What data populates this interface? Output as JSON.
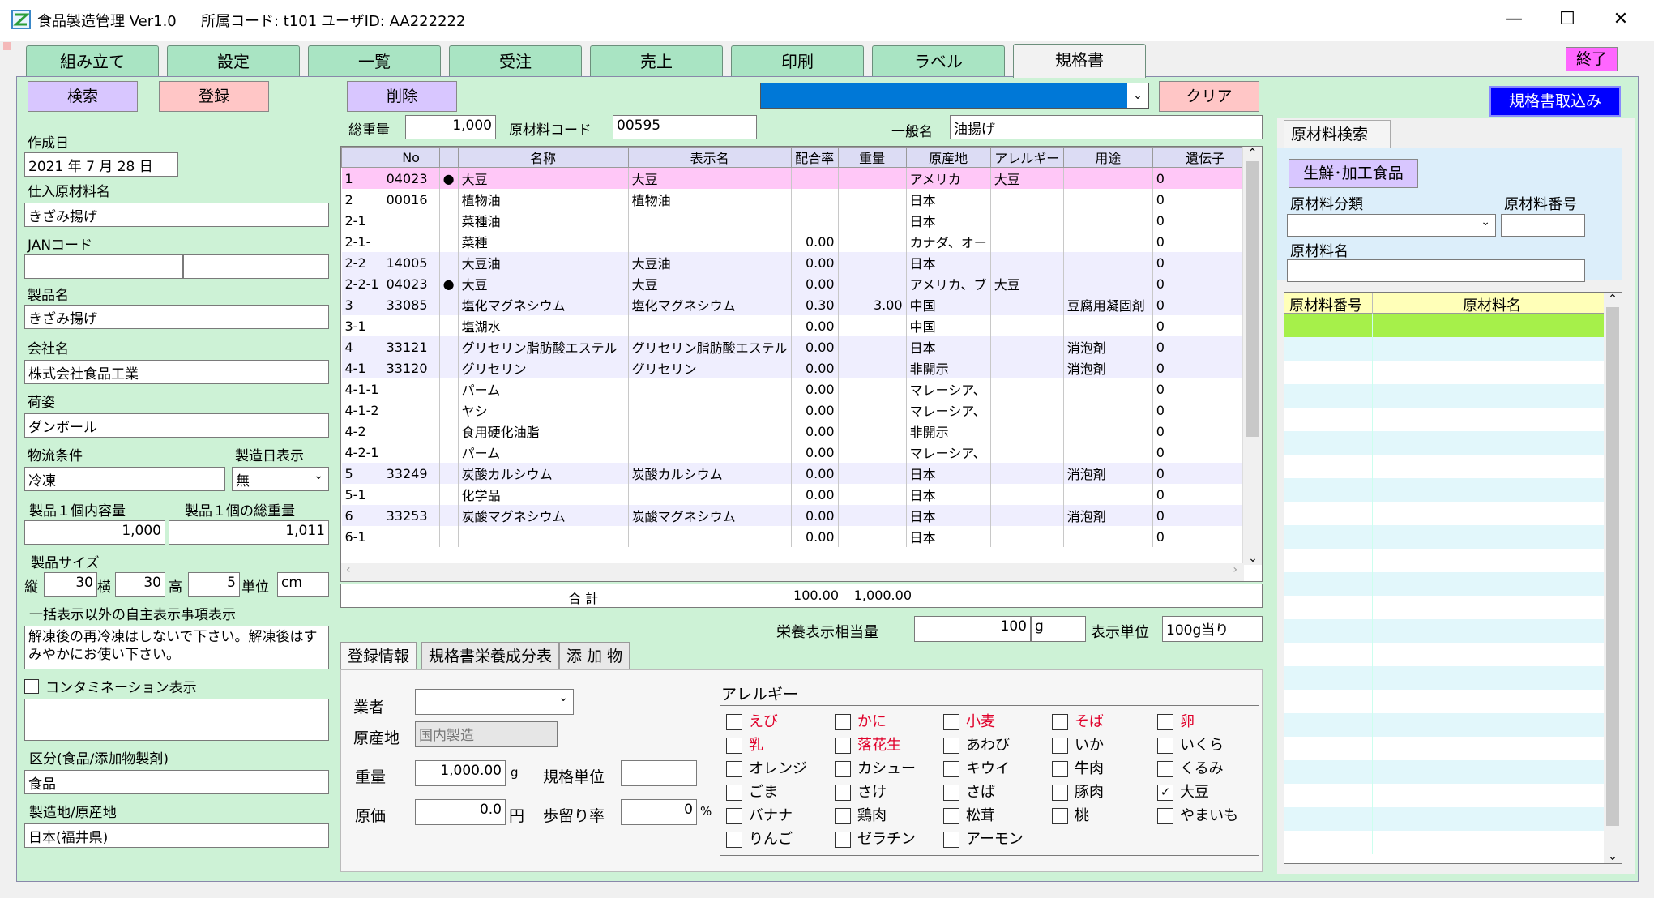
{
  "titlebar": {
    "app_title": "食品製造管理 Ver1.0",
    "office_code": "所属コード: t101",
    "user_id": "ユーザID: AA222222",
    "minimize": "—",
    "maximize": "☐",
    "close": "✕"
  },
  "tabs": [
    {
      "label": "組み立て"
    },
    {
      "label": "設定"
    },
    {
      "label": "一覧"
    },
    {
      "label": "受注"
    },
    {
      "label": "売上"
    },
    {
      "label": "印刷"
    },
    {
      "label": "ラベル"
    },
    {
      "label": "規格書"
    }
  ],
  "exit_label": "終了",
  "toolbar": {
    "search": "検索",
    "register": "登録",
    "delete": "削除",
    "clear": "クリア",
    "import": "規格書取込み"
  },
  "left": {
    "created_date_label": "作成日",
    "created_date": "2021 年 7 月 28 日",
    "material_name_label": "仕入原材料名",
    "material_name": "きざみ揚げ",
    "jan_label": "JANコード",
    "jan_1": "",
    "jan_2": "",
    "product_name_label": "製品名",
    "product_name": "きざみ揚げ",
    "company_label": "会社名",
    "company": "株式会社食品工業",
    "packing_label": "荷姿",
    "packing": "ダンボール",
    "logistics_label": "物流条件",
    "logistics": "冷凍",
    "mfg_date_label": "製造日表示",
    "mfg_date": "無",
    "capacity_label": "製品１個内容量",
    "capacity": "1,000",
    "total_weight_label": "製品１個の総重量",
    "total_weight": "1,011",
    "size_label": "製品サイズ",
    "size_h_label": "縦",
    "size_h": "30",
    "size_w_label": "横",
    "size_w": "30",
    "size_d_label": "高",
    "size_d": "5",
    "unit_label": "単位",
    "unit": "cm",
    "voluntary_label": "一括表示以外の自主表示事項表示",
    "voluntary_text": "解凍後の再冷凍はしないで下さい。解凍後はすみやかにお使い下さい。",
    "contamination_label": "コンタミネーション表示",
    "category_label": "区分(食品/添加物製剤)",
    "category": "食品",
    "origin_label": "製造地/原産地",
    "origin": "日本(福井県)"
  },
  "header_fields": {
    "total_weight_label": "総重量",
    "total_weight": "1,000",
    "material_code_label": "原材料コード",
    "material_code": "00595",
    "general_name_label": "一般名",
    "general_name": "油揚げ"
  },
  "grid": {
    "columns": [
      "",
      "No",
      "",
      "名称",
      "表示名",
      "配合率",
      "重量",
      "原産地",
      "アレルギー",
      "用途",
      "遺伝子"
    ],
    "rows": [
      {
        "c": [
          "1",
          "04023",
          "●",
          "大豆",
          "大豆",
          "",
          "",
          "アメリカ",
          "大豆",
          "",
          "0"
        ]
      },
      {
        "c": [
          "2",
          "00016",
          "",
          "植物油",
          "植物油",
          "",
          "",
          "日本",
          "",
          "",
          "0"
        ]
      },
      {
        "c": [
          "2-1",
          "",
          "",
          "菜種油",
          "",
          "",
          "",
          "日本",
          "",
          "",
          "0"
        ]
      },
      {
        "c": [
          "2-1-",
          "",
          "",
          "菜種",
          "",
          "0.00",
          "",
          "カナダ、オー",
          "",
          "",
          "0"
        ]
      },
      {
        "c": [
          "2-2",
          "14005",
          "",
          "大豆油",
          "大豆油",
          "0.00",
          "",
          "日本",
          "",
          "",
          "0"
        ]
      },
      {
        "c": [
          "2-2-1",
          "04023",
          "●",
          "大豆",
          "大豆",
          "0.00",
          "",
          "アメリカ、ブ",
          "大豆",
          "",
          "0"
        ]
      },
      {
        "c": [
          "3",
          "33085",
          "",
          "塩化マグネシウム",
          "塩化マグネシウム",
          "0.30",
          "3.00",
          "中国",
          "",
          "豆腐用凝固剤",
          "0"
        ]
      },
      {
        "c": [
          "3-1",
          "",
          "",
          "塩湖水",
          "",
          "0.00",
          "",
          "中国",
          "",
          "",
          "0"
        ]
      },
      {
        "c": [
          "4",
          "33121",
          "",
          "グリセリン脂肪酸エステル",
          "グリセリン脂肪酸エステル",
          "0.00",
          "",
          "日本",
          "",
          "消泡剤",
          "0"
        ]
      },
      {
        "c": [
          "4-1",
          "33120",
          "",
          "グリセリン",
          "グリセリン",
          "0.00",
          "",
          "非開示",
          "",
          "消泡剤",
          "0"
        ]
      },
      {
        "c": [
          "4-1-1",
          "",
          "",
          "パーム",
          "",
          "0.00",
          "",
          "マレーシア、",
          "",
          "",
          "0"
        ]
      },
      {
        "c": [
          "4-1-2",
          "",
          "",
          "ヤシ",
          "",
          "0.00",
          "",
          "マレーシア、",
          "",
          "",
          "0"
        ]
      },
      {
        "c": [
          "4-2",
          "",
          "",
          "食用硬化油脂",
          "",
          "0.00",
          "",
          "非開示",
          "",
          "",
          "0"
        ]
      },
      {
        "c": [
          "4-2-1",
          "",
          "",
          "パーム",
          "",
          "0.00",
          "",
          "マレーシア、",
          "",
          "",
          "0"
        ]
      },
      {
        "c": [
          "5",
          "33249",
          "",
          "炭酸カルシウム",
          "炭酸カルシウム",
          "0.00",
          "",
          "日本",
          "",
          "消泡剤",
          "0"
        ]
      },
      {
        "c": [
          "5-1",
          "",
          "",
          "化学品",
          "",
          "0.00",
          "",
          "日本",
          "",
          "",
          "0"
        ]
      },
      {
        "c": [
          "6",
          "33253",
          "",
          "炭酸マグネシウム",
          "炭酸マグネシウム",
          "0.00",
          "",
          "日本",
          "",
          "消泡剤",
          "0"
        ]
      },
      {
        "c": [
          "6-1",
          "",
          "",
          "",
          "",
          "0.00",
          "",
          "日本",
          "",
          "",
          "0"
        ]
      }
    ],
    "total_label": "合 計",
    "total_rate": "100.00",
    "total_weight": "1,000.00"
  },
  "nutrition": {
    "equivalent_label": "栄養表示相当量",
    "equivalent": "100",
    "equivalent_unit": "g",
    "display_unit_label": "表示単位",
    "display_unit": "100g当り"
  },
  "subtabs": [
    "登録情報",
    "規格書栄養成分表",
    "添 加 物"
  ],
  "reg": {
    "vendor_label": "業者",
    "vendor": "",
    "origin_label": "原産地",
    "origin_placeholder": "国内製造",
    "weight_label": "重量",
    "weight": "1,000.00",
    "weight_unit": "g",
    "spec_unit_label": "規格単位",
    "spec_unit": "",
    "cost_label": "原価",
    "cost": "0.0",
    "cost_unit": "円",
    "yield_label": "歩留り率",
    "yield": "0",
    "yield_unit": "%"
  },
  "allergy": {
    "title": "アレルギー",
    "items": [
      {
        "label": "えび",
        "checked": false,
        "red": true
      },
      {
        "label": "かに",
        "checked": false,
        "red": true
      },
      {
        "label": "小麦",
        "checked": false,
        "red": true
      },
      {
        "label": "そば",
        "checked": false,
        "red": true
      },
      {
        "label": "卵",
        "checked": false,
        "red": true
      },
      {
        "label": "乳",
        "checked": false,
        "red": true
      },
      {
        "label": "落花生",
        "checked": false,
        "red": true
      },
      {
        "label": "あわび",
        "checked": false,
        "red": false
      },
      {
        "label": "いか",
        "checked": false,
        "red": false
      },
      {
        "label": "いくら",
        "checked": false,
        "red": false
      },
      {
        "label": "オレンジ",
        "checked": false,
        "red": false
      },
      {
        "label": "カシュー",
        "checked": false,
        "red": false
      },
      {
        "label": "キウイ",
        "checked": false,
        "red": false
      },
      {
        "label": "牛肉",
        "checked": false,
        "red": false
      },
      {
        "label": "くるみ",
        "checked": false,
        "red": false
      },
      {
        "label": "ごま",
        "checked": false,
        "red": false
      },
      {
        "label": "さけ",
        "checked": false,
        "red": false
      },
      {
        "label": "さば",
        "checked": false,
        "red": false
      },
      {
        "label": "豚肉",
        "checked": false,
        "red": false
      },
      {
        "label": "大豆",
        "checked": true,
        "red": false
      },
      {
        "label": "バナナ",
        "checked": false,
        "red": false
      },
      {
        "label": "鶏肉",
        "checked": false,
        "red": false
      },
      {
        "label": "松茸",
        "checked": false,
        "red": false
      },
      {
        "label": "桃",
        "checked": false,
        "red": false
      },
      {
        "label": "やまいも",
        "checked": false,
        "red": false
      },
      {
        "label": "りんご",
        "checked": false,
        "red": false
      },
      {
        "label": "ゼラチン",
        "checked": false,
        "red": false
      },
      {
        "label": "アーモン",
        "checked": false,
        "red": false
      }
    ]
  },
  "right": {
    "tab_label": "原材料検索",
    "fresh_btn": "生鮮･加工食品",
    "class_label": "原材料分類",
    "number_label": "原材料番号",
    "name_label": "原材料名",
    "col_number": "原材料番号",
    "col_name": "原材料名"
  },
  "colors": {
    "tab": "#a9e4c3",
    "panel": "#cdf2d6",
    "purple_btn": "#d8c6ff",
    "pink_btn": "#ffc6c6",
    "selected_row": "#ffc7f7",
    "import_btn": "#0000ff",
    "exit_btn": "#ff66ff"
  }
}
